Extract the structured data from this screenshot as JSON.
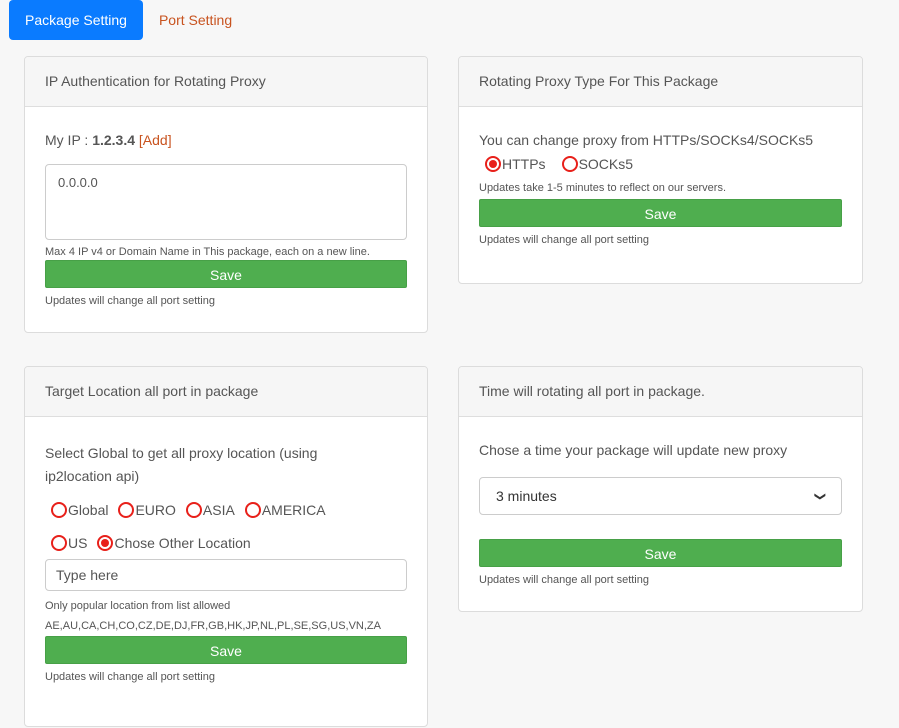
{
  "tabs": [
    {
      "label": "Package Setting",
      "active": true
    },
    {
      "label": "Port Setting",
      "active": false
    }
  ],
  "ip_auth": {
    "title": "IP Authentication for Rotating Proxy",
    "my_ip_label": "My IP :",
    "my_ip_value": "1.2.3.4",
    "add_label": "[Add]",
    "textarea_value": "0.0.0.0",
    "hint": "Max 4 IP v4 or Domain Name in This package, each on a new line.",
    "save_label": "Save",
    "note": "Updates will change all port setting"
  },
  "proxy_type": {
    "title": "Rotating Proxy Type For This Package",
    "lead": "You can change proxy from HTTPs/SOCKs4/SOCKs5",
    "options": [
      {
        "label": "HTTPs",
        "checked": true
      },
      {
        "label": "SOCKs5",
        "checked": false
      }
    ],
    "hint": "Updates take 1-5 minutes to reflect on our servers.",
    "save_label": "Save",
    "note": "Updates will change all port setting"
  },
  "target_location": {
    "title": "Target Location all port in package",
    "lead": "Select Global to get all proxy location (using ip2location api)",
    "options_row1": [
      {
        "label": "Global",
        "checked": false
      },
      {
        "label": "EURO",
        "checked": false
      },
      {
        "label": "ASIA",
        "checked": false
      },
      {
        "label": "AMERICA",
        "checked": false
      }
    ],
    "options_row2": [
      {
        "label": "US",
        "checked": false
      },
      {
        "label": "Chose Other Location",
        "checked": true
      }
    ],
    "input_placeholder": "Type here",
    "hint": "Only popular location from list allowed",
    "allowed_list": "AE,AU,CA,CH,CO,CZ,DE,DJ,FR,GB,HK,JP,NL,PL,SE,SG,US,VN,ZA",
    "save_label": "Save",
    "note": "Updates will change all port setting"
  },
  "rotation_time": {
    "title": "Time will rotating all port in package.",
    "lead": "Chose a time your package will update new proxy",
    "selected": "3 minutes",
    "save_label": "Save",
    "note": "Updates will change all port setting"
  },
  "colors": {
    "primary": "#0a7bff",
    "link": "#c8531f",
    "success": "#4fae4f",
    "radio": "#e8201a"
  }
}
